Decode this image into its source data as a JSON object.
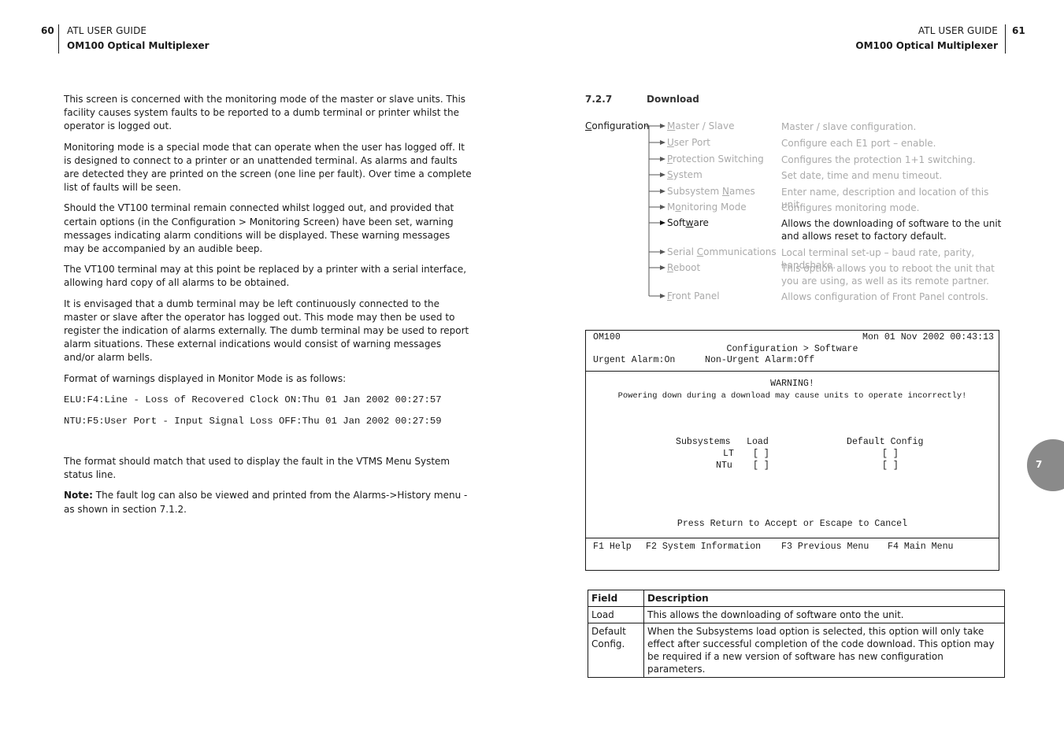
{
  "left_page": {
    "page_number": "60",
    "header_title": "ATL USER GUIDE",
    "header_subtitle": "OM100 Optical Multiplexer",
    "paragraphs": [
      "This screen is concerned with the monitoring mode of the master or slave units. This facility causes system faults to be reported to a dumb terminal or printer whilst the operator is logged out.",
      "Monitoring mode is a special mode that can operate when the user has logged off. It is designed to connect to a printer or an unattended terminal. As alarms and faults are detected they are printed on the screen (one line per fault). Over time a complete list of faults will be seen.",
      "Should the VT100 terminal remain connected whilst logged out, and provided that certain options (in the Configuration > Monitoring Screen) have been set, warning messages indicating alarm conditions will be displayed. These warning messages may be accompanied by an audible beep.",
      "The VT100 terminal may at this point be replaced by a printer with a serial interface, allowing hard copy of all alarms to be obtained.",
      "It is envisaged that a dumb terminal may be left continuously connected to the master or slave after the operator has logged out. This mode may then be used to register the indication of alarms externally. The dumb terminal may be used to report alarm situations. These external indications would consist of warning messages and/or alarm bells.",
      "Format of warnings displayed in Monitor Mode is as follows:"
    ],
    "code_lines": [
      "ELU:F4:Line - Loss of Recovered Clock ON:Thu 01 Jan 2002 00:27:57",
      "NTU:F5:User Port - Input Signal Loss OFF:Thu 01 Jan 2002 00:27:59"
    ],
    "after_code": "The format should match that used to display the fault in the VTMS Menu System status line.",
    "note_label": "Note:",
    "note_text": " The fault log can also be viewed and printed from the Alarms->History menu - as shown in section 7.1.2."
  },
  "right_page": {
    "page_number": "61",
    "header_title": "ATL USER GUIDE",
    "header_subtitle": "OM100 Optical Multiplexer",
    "section_number": "7.2.7",
    "section_title": "Download",
    "chapter_tab": "7",
    "menu_root": {
      "underline": "C",
      "rest": "onfiguration"
    },
    "menu_items": [
      {
        "pre": "",
        "u": "M",
        "post": "aster / Slave",
        "desc": "Master / slave configuration.",
        "active": false
      },
      {
        "pre": "",
        "u": "U",
        "post": "ser Port",
        "desc": "Configure each E1 port – enable.",
        "active": false
      },
      {
        "pre": "",
        "u": "P",
        "post": "rotection Switching",
        "desc": "Configures the protection 1+1 switching.",
        "active": false
      },
      {
        "pre": "",
        "u": "S",
        "post": "ystem",
        "desc": "Set date, time and menu timeout.",
        "active": false
      },
      {
        "pre": "Subsystem ",
        "u": "N",
        "post": "ames",
        "desc": "Enter name, description and location of this unit.",
        "active": false
      },
      {
        "pre": "M",
        "u": "o",
        "post": "nitoring Mode",
        "desc": "Configures monitoring mode.",
        "active": false
      },
      {
        "pre": "Soft",
        "u": "w",
        "post": "are",
        "desc": "Allows the downloading of software to the unit and allows reset to factory default.",
        "active": true
      },
      {
        "pre": "Serial ",
        "u": "C",
        "post": "ommunications",
        "desc": "Local terminal set-up – baud rate, parity, handshake.",
        "active": false
      },
      {
        "pre": "",
        "u": "R",
        "post": "eboot",
        "desc": "This option allows you to reboot the unit that you are using, as well as its remote partner.",
        "active": false
      },
      {
        "pre": "",
        "u": "F",
        "post": "ront Panel",
        "desc": "Allows configuration of Front Panel controls.",
        "active": false
      }
    ],
    "terminal": {
      "unit": "OM100",
      "datetime": "Mon 01 Nov 2002 00:43:13",
      "breadcrumb": "Configuration > Software",
      "urgent_alarm": "Urgent Alarm:On",
      "non_urgent_alarm": "Non-Urgent Alarm:Off",
      "warning_title": "WARNING!",
      "warning_text": "Powering down during a download may cause units to operate incorrectly!",
      "col_subsystems": "Subsystems",
      "col_load": "Load",
      "col_default": "Default Config",
      "rows": [
        {
          "name": "LT",
          "load": "[ ]",
          "default": "[ ]"
        },
        {
          "name": "NTu",
          "load": "[ ]",
          "default": "[ ]"
        }
      ],
      "prompt": "Press Return to Accept or Escape to Cancel",
      "function_keys": [
        "F1 Help",
        "F2 System Information",
        "F3 Previous Menu",
        "F4 Main Menu"
      ]
    },
    "field_table": {
      "headers": [
        "Field",
        "Description"
      ],
      "rows": [
        {
          "field": "Load",
          "description": "This allows the downloading of software onto the unit."
        },
        {
          "field": "Default Config.",
          "description": "When the Subsystems load option is selected, this option will only take  effect after successful completion of the code download. This option   may be required if a new version of software has new configuration   parameters."
        }
      ]
    }
  }
}
